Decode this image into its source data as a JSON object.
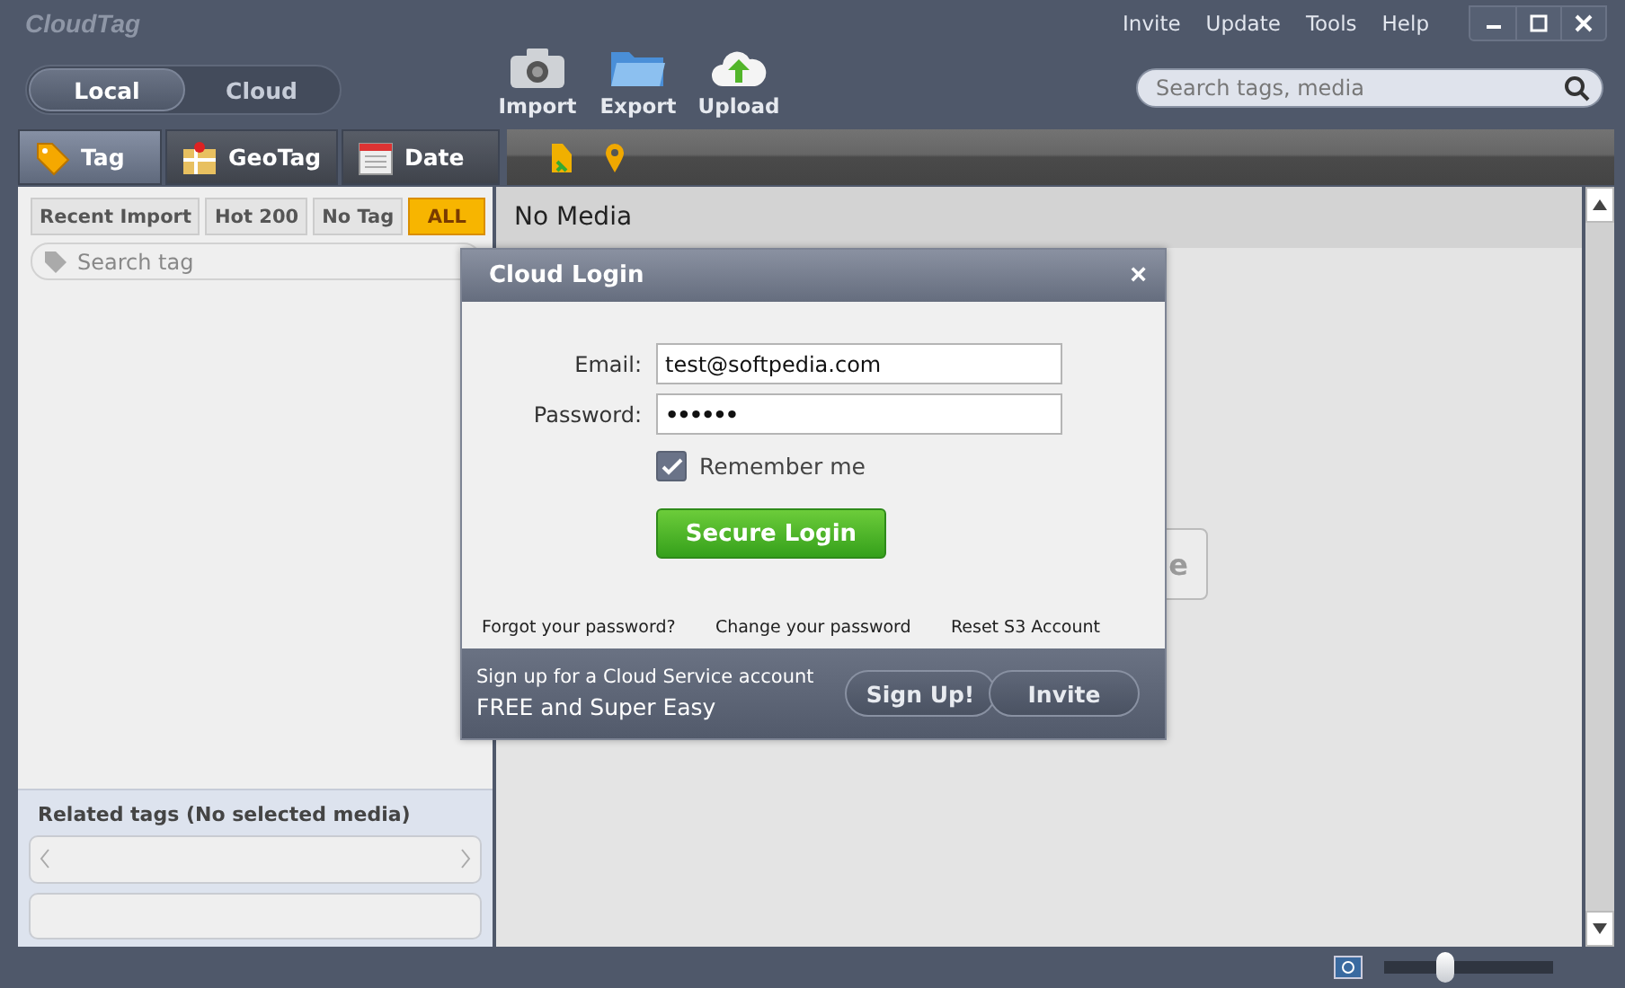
{
  "app": {
    "logo": "CloudTag"
  },
  "menu": [
    "Invite",
    "Update",
    "Tools",
    "Help"
  ],
  "source_toggle": [
    {
      "label": "Local",
      "selected": true
    },
    {
      "label": "Cloud",
      "selected": false
    }
  ],
  "toolbar": [
    {
      "label": "Import",
      "kind": "camera"
    },
    {
      "label": "Export",
      "kind": "folder"
    },
    {
      "label": "Upload",
      "kind": "cloud"
    }
  ],
  "search": {
    "placeholder": "Search tags, media"
  },
  "tabs": [
    {
      "label": "Tag",
      "kind": "tag",
      "selected": true
    },
    {
      "label": "GeoTag",
      "kind": "map",
      "selected": false
    },
    {
      "label": "Date",
      "kind": "calendar",
      "selected": false
    }
  ],
  "filters": [
    {
      "label": "Recent Import",
      "selected": false
    },
    {
      "label": "Hot 200",
      "selected": false
    },
    {
      "label": "No Tag",
      "selected": false
    },
    {
      "label": "ALL",
      "selected": true
    }
  ],
  "tag_search": {
    "placeholder": "Search tag"
  },
  "related_tags": {
    "title": "Related tags (No selected media)"
  },
  "content": {
    "title": "No Media",
    "hidden_button": "e"
  },
  "zoom": {
    "level": 0.36
  },
  "dialog": {
    "title": "Cloud Login",
    "close": "×",
    "fields": [
      {
        "label": "Email:",
        "value": "test@softpedia.com",
        "kind": "text"
      },
      {
        "label": "Password:",
        "value": "••••••",
        "kind": "password"
      }
    ],
    "remember": {
      "label": "Remember me",
      "checked": true
    },
    "login": "Secure Login",
    "links": [
      "Forgot your password?",
      "Change your password",
      "Reset S3 Account"
    ],
    "signup_line1": "Sign up for a Cloud Service account",
    "signup_line2": "FREE and Super Easy",
    "buttons": [
      "Sign Up!",
      "Invite"
    ]
  }
}
